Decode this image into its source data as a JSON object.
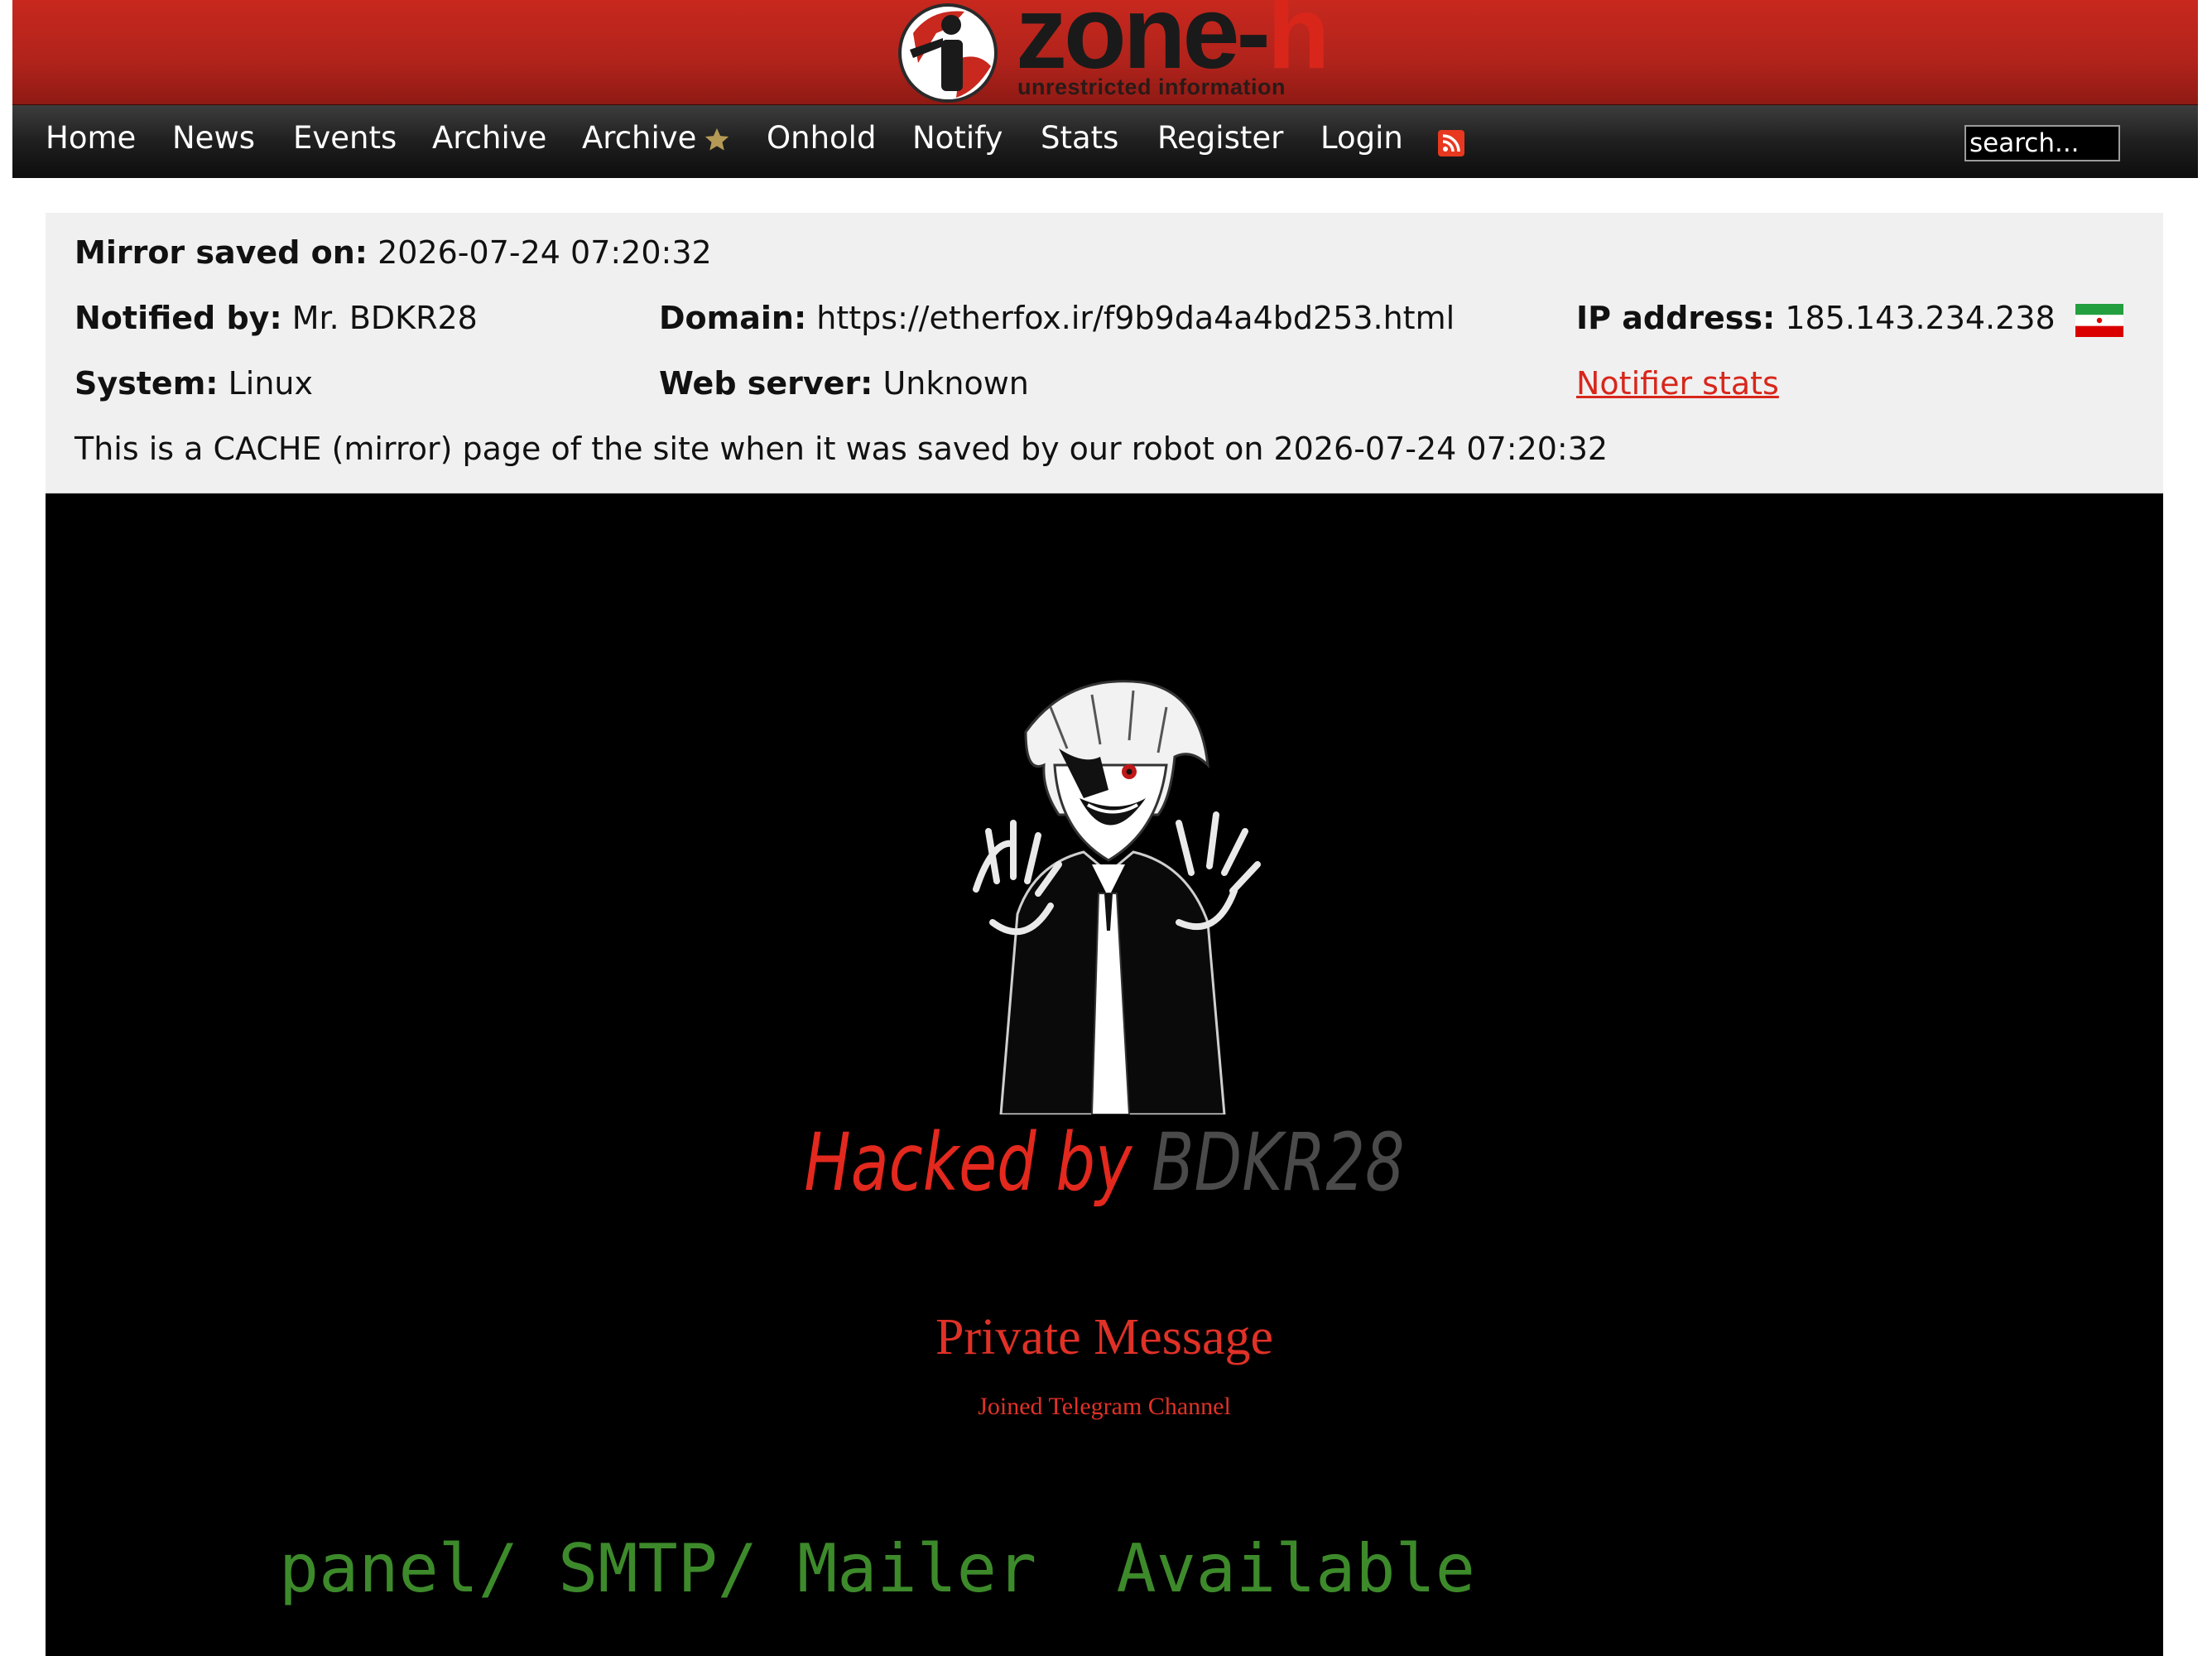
{
  "header": {
    "logo_main": "zone-",
    "logo_accent": "h",
    "logo_tagline": "unrestricted information"
  },
  "nav": {
    "items": [
      "Home",
      "News",
      "Events",
      "Archive",
      "Archive",
      "Onhold",
      "Notify",
      "Stats",
      "Register",
      "Login"
    ],
    "rss_icon": "rss-feed-icon",
    "star_icon": "star-icon",
    "search_placeholder": "search..."
  },
  "info": {
    "mirror_saved_label": "Mirror saved on:",
    "mirror_saved_value": "2026-07-24 07:20:32",
    "notified_label": "Notified by:",
    "notified_value": "Mr. BDKR28",
    "domain_label": "Domain:",
    "domain_value": "https://etherfox.ir/f9b9da4a4bd253.html",
    "ip_label": "IP address:",
    "ip_value": "185.143.234.238",
    "flag_icon": "iran-flag-icon",
    "system_label": "System:",
    "system_value": "Linux",
    "webserver_label": "Web server:",
    "webserver_value": "Unknown",
    "notifier_stats_link": "Notifier stats",
    "cache_note": "This is a CACHE (mirror) page of the site when it was saved by our robot on 2026-07-24 07:20:32"
  },
  "mirror": {
    "hacked_by": "Hacked by",
    "hacker_name": "BDKR28",
    "private_message": "Private Message",
    "telegram": "Joined Telegram Channel",
    "panel_text": "panel/ SMTP/ Mailer  Available"
  },
  "colors": {
    "header_red": "#b0231b",
    "accent_red": "#d8261b",
    "panel_green": "#3d8a2b"
  }
}
